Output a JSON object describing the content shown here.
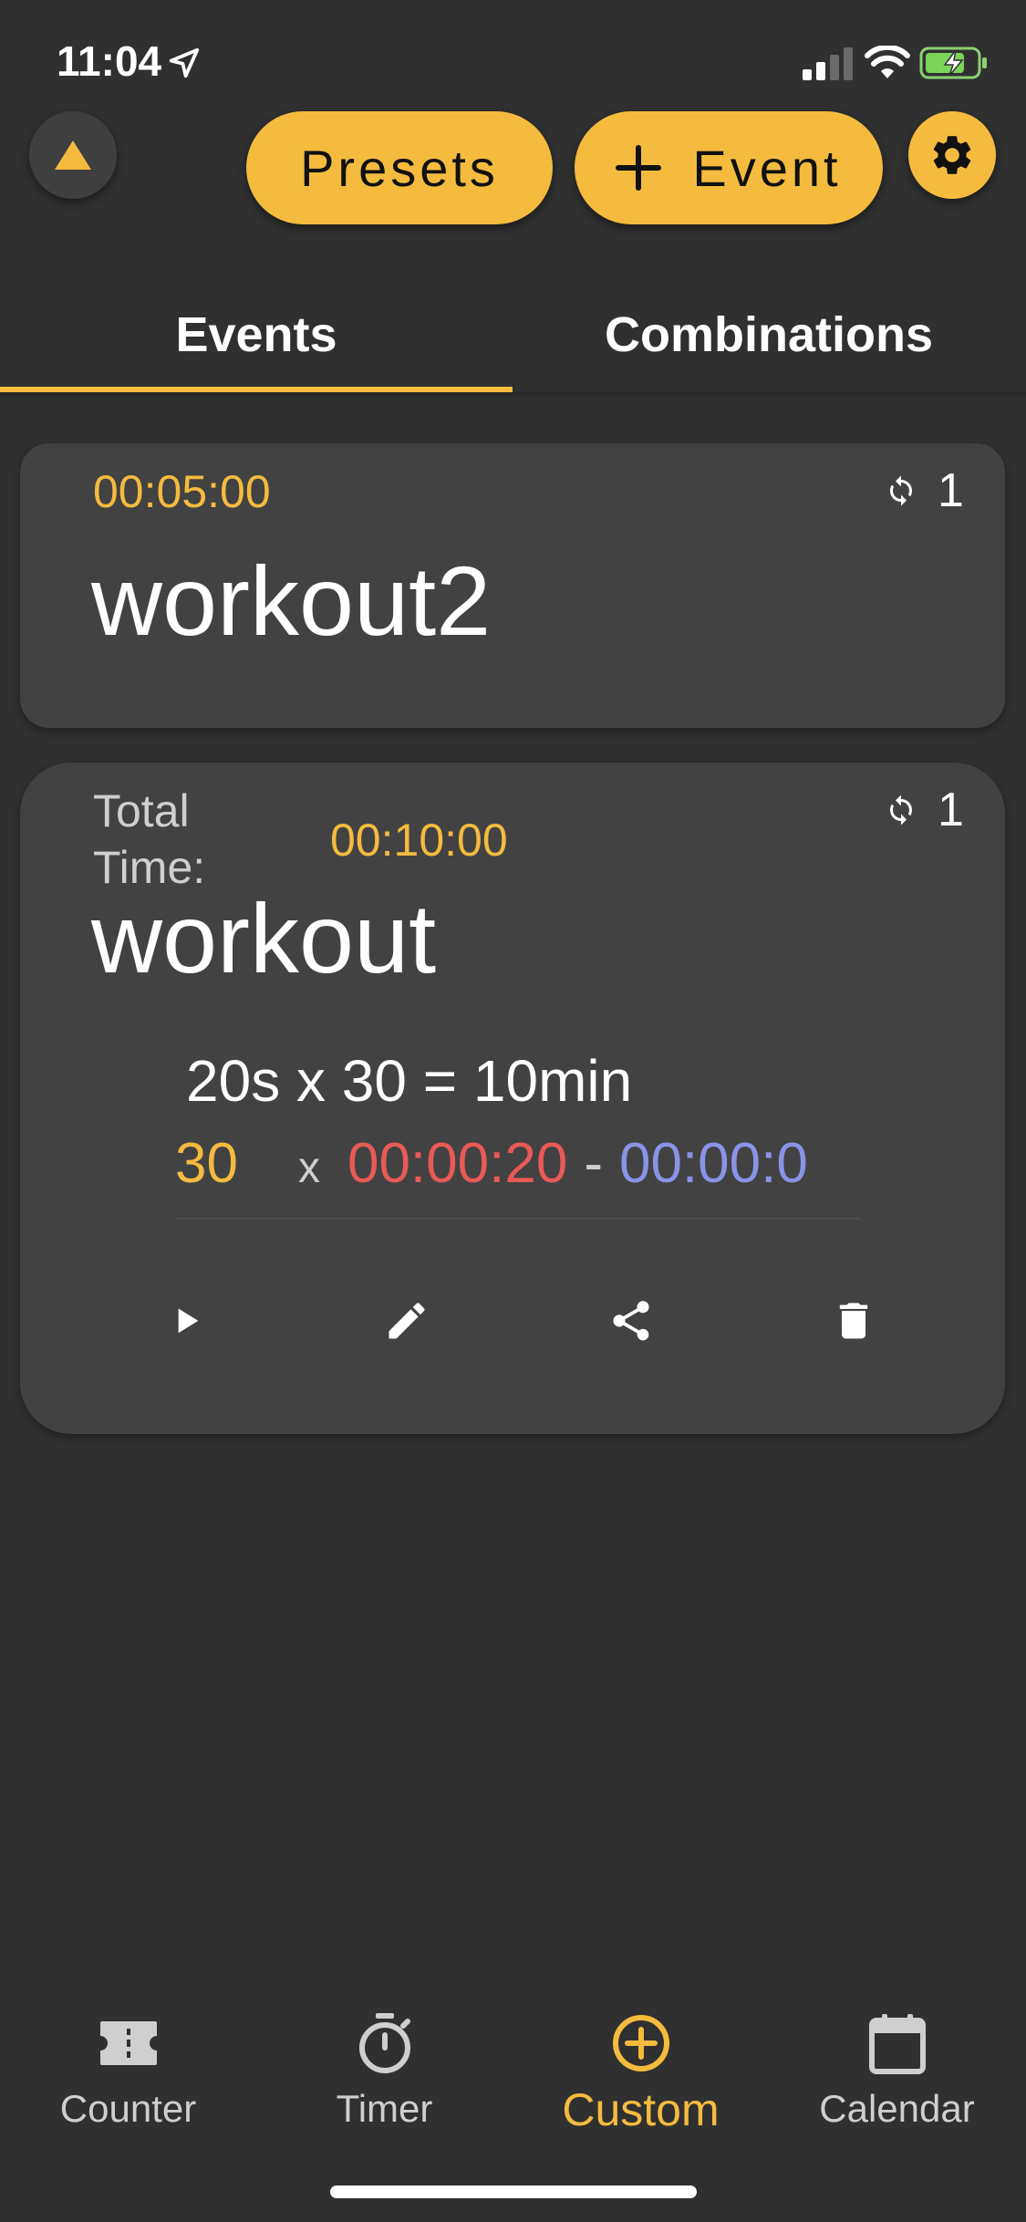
{
  "status_bar": {
    "time": "11:04"
  },
  "header": {
    "presets_label": "Presets",
    "add_event_label": "Event",
    "add_event_icon": "plus-icon",
    "collapse_icon": "triangle-up-icon",
    "settings_icon": "gear-icon"
  },
  "tabs": {
    "items": [
      {
        "label": "Events",
        "active": true
      },
      {
        "label": "Combinations",
        "active": false
      }
    ]
  },
  "events": [
    {
      "time": "00:05:00",
      "repeat": "1",
      "name": "workout2"
    },
    {
      "total_label": "Total Time:",
      "total_label_line1": "Total",
      "total_label_line2": "Time:",
      "time": "00:10:00",
      "repeat": "1",
      "name": "workout",
      "summary": "20s x 30 = 10min",
      "rounds": "30",
      "times_symbol": "x",
      "work_time": "00:00:20",
      "dash": "-",
      "rest_time": "00:00:0",
      "actions": [
        "play-icon",
        "edit-icon",
        "share-icon",
        "delete-icon"
      ]
    }
  ],
  "bottom_nav": {
    "items": [
      {
        "label": "Counter",
        "icon": "ticket-icon",
        "active": false
      },
      {
        "label": "Timer",
        "icon": "stopwatch-icon",
        "active": false
      },
      {
        "label": "Custom",
        "icon": "plus-circle-icon",
        "active": true
      },
      {
        "label": "Calendar",
        "icon": "calendar-icon",
        "active": false
      }
    ]
  },
  "colors": {
    "background": "#303030",
    "card": "#424242",
    "accent": "#f4bb3f",
    "work": "#e85a56",
    "rest": "#8b93e8"
  }
}
